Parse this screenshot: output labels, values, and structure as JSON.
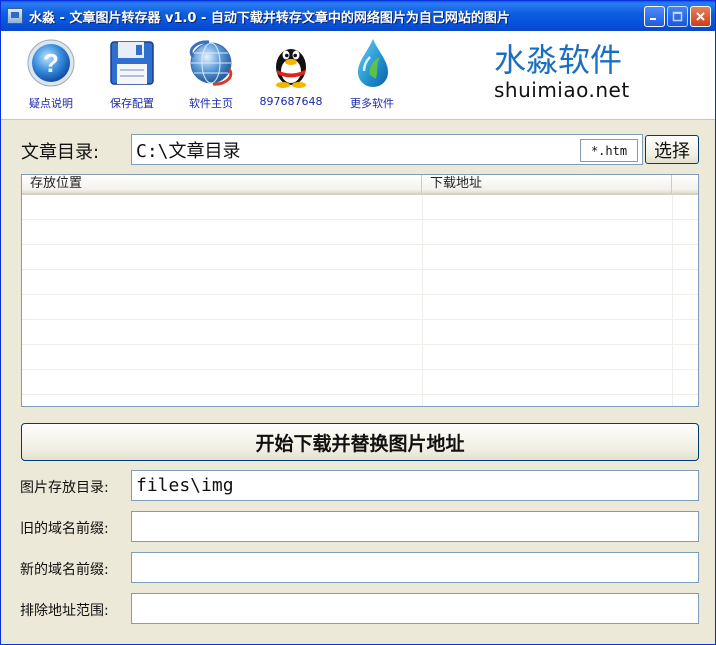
{
  "window": {
    "title": "水淼 - 文章图片转存器 v1.0 - 自动下载并转存文章中的网络图片为自己网站的图片"
  },
  "toolbar": {
    "items": [
      {
        "label": "疑点说明",
        "icon": "help-icon"
      },
      {
        "label": "保存配置",
        "icon": "floppy-disk-icon"
      },
      {
        "label": "软件主页",
        "icon": "globe-icon"
      },
      {
        "label": "897687648",
        "icon": "qq-penguin-icon"
      },
      {
        "label": "更多软件",
        "icon": "water-drop-icon"
      }
    ]
  },
  "brand": {
    "name_cn": "水淼软件",
    "domain": "shuimiao.net",
    "color": "#1b6fc0"
  },
  "article_dir": {
    "label": "文章目录:",
    "value": "C:\\文章目录",
    "ext_filter": "*.htm",
    "select_label": "选择"
  },
  "list": {
    "columns": [
      "存放位置",
      "下载地址"
    ],
    "rows": []
  },
  "action": {
    "label": "开始下载并替换图片地址"
  },
  "fields": {
    "image_dir": {
      "label": "图片存放目录:",
      "value": "files\\img"
    },
    "old_prefix": {
      "label": "旧的域名前缀:",
      "value": ""
    },
    "new_prefix": {
      "label": "新的域名前缀:",
      "value": ""
    },
    "exclude_range": {
      "label": "排除地址范围:",
      "value": ""
    }
  }
}
